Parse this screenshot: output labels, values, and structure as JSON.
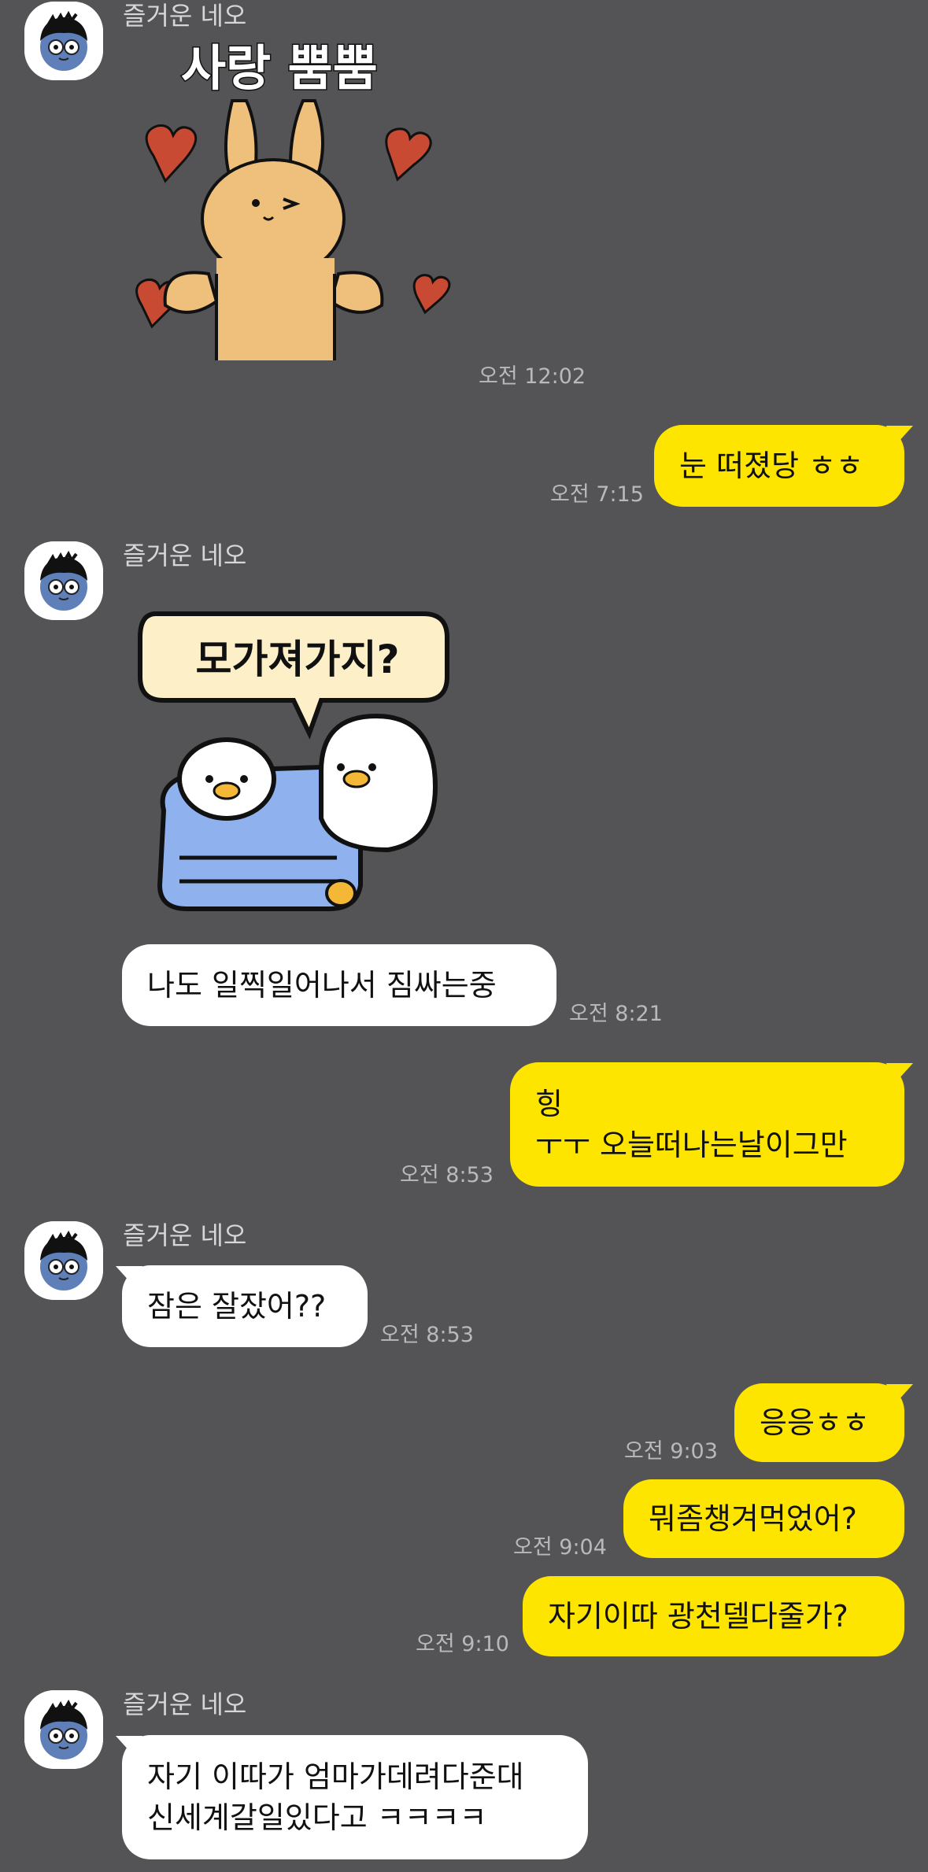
{
  "contact": {
    "name": "즐거운 네오"
  },
  "colors": {
    "background": "#545457",
    "my_bubble": "#fee500",
    "their_bubble": "#ffffff"
  },
  "messages": [
    {
      "from": "them",
      "type": "sticker",
      "sticker_text": "사랑 뿜뿜",
      "time": "오전 12:02"
    },
    {
      "from": "me",
      "type": "text",
      "lines": [
        "눈 떠졌당 ㅎㅎ"
      ],
      "time": "오전 7:15"
    },
    {
      "from": "them",
      "type": "sticker",
      "sticker_text": "모가져가지?",
      "time": ""
    },
    {
      "from": "them",
      "type": "text",
      "lines": [
        "나도 일찍일어나서 짐싸는중"
      ],
      "time": "오전 8:21"
    },
    {
      "from": "me",
      "type": "text",
      "lines": [
        "힝",
        "ㅜㅜ 오늘떠나는날이그만"
      ],
      "time": "오전 8:53"
    },
    {
      "from": "them",
      "type": "text",
      "lines": [
        "잠은 잘잤어??"
      ],
      "time": "오전 8:53"
    },
    {
      "from": "me",
      "type": "text",
      "lines": [
        "응응ㅎㅎ"
      ],
      "time": "오전 9:03"
    },
    {
      "from": "me",
      "type": "text",
      "lines": [
        "뭐좀챙겨먹었어?"
      ],
      "time": "오전 9:04"
    },
    {
      "from": "me",
      "type": "text",
      "lines": [
        "자기이따 광천델다줄가?"
      ],
      "time": "오전 9:10"
    },
    {
      "from": "them",
      "type": "text",
      "lines": [
        "자기 이따가 엄마가데려다준대",
        "신세계갈일있다고 ㅋㅋㅋㅋ"
      ],
      "time": ""
    }
  ],
  "icons": {
    "avatar": "neo-character-avatar-icon"
  }
}
